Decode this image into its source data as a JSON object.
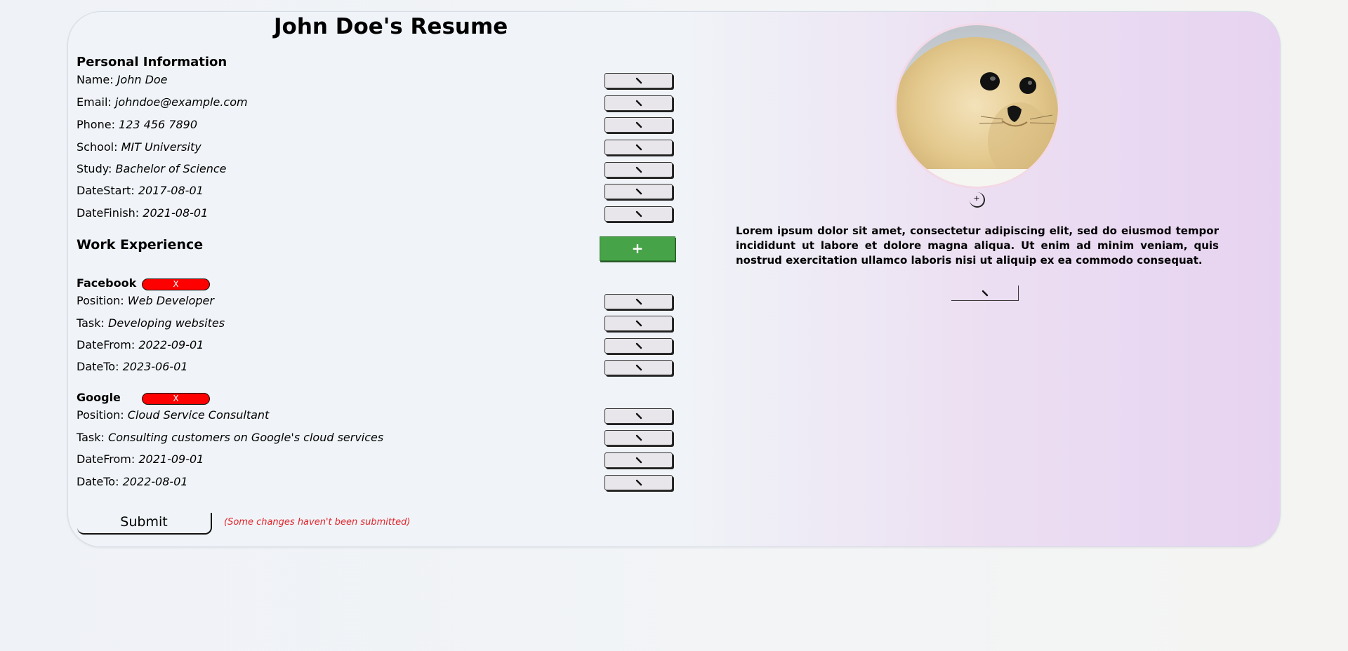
{
  "page": {
    "title": "John Doe's Resume"
  },
  "personal": {
    "heading": "Personal Information",
    "fields": [
      {
        "label": "Name: ",
        "value": "John Doe"
      },
      {
        "label": "Email: ",
        "value": "johndoe@example.com"
      },
      {
        "label": "Phone: ",
        "value": "123 456 7890"
      },
      {
        "label": "School: ",
        "value": "MIT University"
      },
      {
        "label": "Study: ",
        "value": "Bachelor of Science"
      },
      {
        "label": "DateStart: ",
        "value": "2017-08-01"
      },
      {
        "label": "DateFinish: ",
        "value": "2021-08-01"
      }
    ]
  },
  "work": {
    "heading": "Work Experience",
    "add_label": "+",
    "delete_label": "X",
    "jobs": [
      {
        "company": "Facebook",
        "fields": [
          {
            "label": "Position: ",
            "value": "Web Developer"
          },
          {
            "label": "Task: ",
            "value": "Developing websites"
          },
          {
            "label": "DateFrom: ",
            "value": "2022-09-01"
          },
          {
            "label": "DateTo: ",
            "value": "2023-06-01"
          }
        ]
      },
      {
        "company": "Google",
        "fields": [
          {
            "label": "Position: ",
            "value": "Cloud Service Consultant"
          },
          {
            "label": "Task: ",
            "value": "Consulting customers on Google's cloud services"
          },
          {
            "label": "DateFrom: ",
            "value": "2021-09-01"
          },
          {
            "label": "DateTo: ",
            "value": "2022-08-01"
          }
        ]
      }
    ]
  },
  "submit": {
    "label": "Submit",
    "warning": "(Some changes haven't been submitted)"
  },
  "profile": {
    "upload_label": "+",
    "bio": "Lorem ipsum dolor sit amet, consectetur adipiscing elit, sed do eiusmod tempor incididunt ut labore et dolore magna aliqua. Ut enim ad minim veniam, quis nostrud exercitation ullamco laboris nisi ut aliquip ex ea commodo consequat."
  },
  "icons": {
    "edit": "pencil-icon",
    "avatar": "seal-pup-photo"
  },
  "colors": {
    "add": "#47a347",
    "delete": "#ff0000",
    "warning": "#e0242a"
  }
}
